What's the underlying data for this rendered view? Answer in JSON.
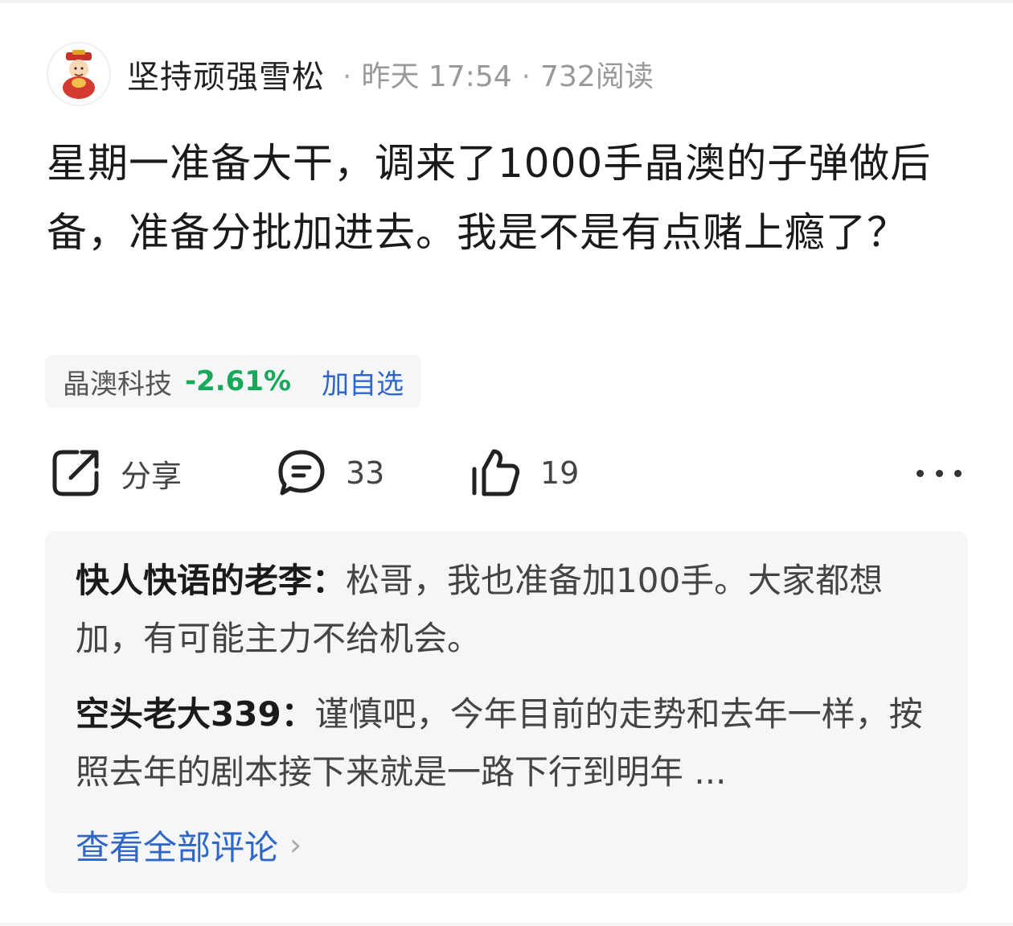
{
  "post": {
    "author": "坚持顽强雪松",
    "time": "昨天 17:54",
    "reads": "732阅读",
    "content": "星期一准备大干，调来了1000手晶澳的子弹做后备，准备分批加进去。我是不是有点赌上瘾了？"
  },
  "stock": {
    "name": "晶澳科技",
    "change": "-2.61%",
    "watch_label": "加自选",
    "change_color": "#1aa75a"
  },
  "actions": {
    "share_label": "分享",
    "comment_count": "33",
    "like_count": "19"
  },
  "comments": [
    {
      "user": "快人快语的老李：",
      "text": "松哥，我也准备加100手。大家都想加，有可能主力不给机会。"
    },
    {
      "user": "空头老大339：",
      "text": "谨慎吧，今年目前的走势和去年一样，按照去年的剧本接下来就是一路下行到明年 ..."
    }
  ],
  "view_all_label": "查看全部评论",
  "colors": {
    "accent": "#2f66c8",
    "panel_bg": "#f5f6f8"
  }
}
